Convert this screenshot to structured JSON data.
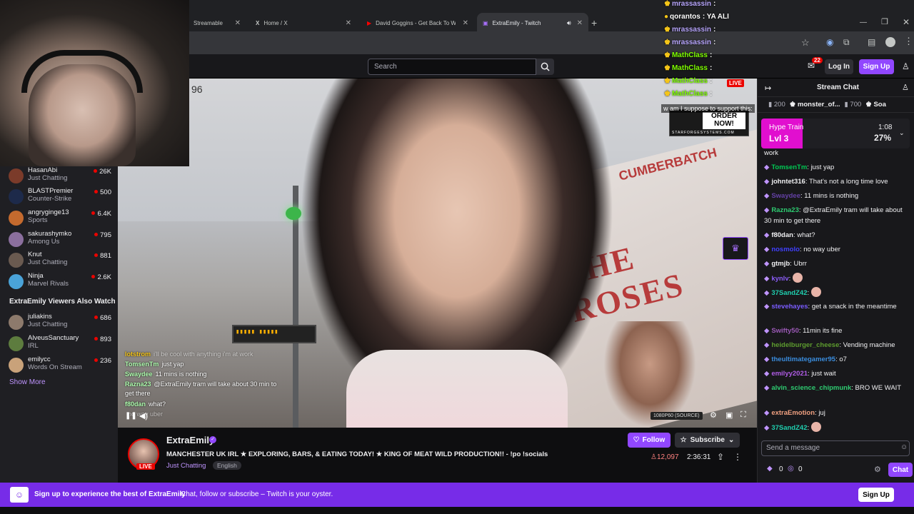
{
  "browser": {
    "tabs": [
      {
        "title": "Streamable"
      },
      {
        "title": "Home / X"
      },
      {
        "title": "David Goggins - Get Back To W"
      },
      {
        "title": "ExtraEmily - Twitch"
      }
    ]
  },
  "topnav": {
    "search_placeholder": "Search",
    "notif_count": "22",
    "login_label": "Log In",
    "signup_label": "Sign Up"
  },
  "overlay_chat": [
    {
      "user": "mrassassin",
      "text": ":"
    },
    {
      "user": "qorantos",
      "text": ": YA ALI"
    },
    {
      "user": "mrassassin",
      "text": ":"
    },
    {
      "user": "mrassassin",
      "text": ":"
    },
    {
      "user": "MathClass",
      "text": ":"
    },
    {
      "user": "MathClass",
      "text": ":"
    },
    {
      "user": "MathClass",
      "text": ":"
    },
    {
      "user": "MathClass",
      "text": ":"
    }
  ],
  "overlay_misc": {
    "live_tag": "LIVE",
    "support_text": "w am I suppose to support this:",
    "order_now": "ORDER NOW!",
    "order_site": "STARFORGESYSTEMS.COM",
    "corner_number": "96"
  },
  "sidebar": {
    "channels": [
      {
        "name": "HasanAbi",
        "category": "Just Chatting",
        "viewers": "26K",
        "color": "#7b3b2a"
      },
      {
        "name": "BLASTPremier",
        "category": "Counter-Strike",
        "viewers": "500",
        "color": "#1d2a4a"
      },
      {
        "name": "angryginge13",
        "category": "Sports",
        "viewers": "6.4K",
        "color": "#c46a2e"
      },
      {
        "name": "sakurashymko",
        "category": "Among Us",
        "viewers": "795",
        "color": "#8b6f9e"
      },
      {
        "name": "Knut",
        "category": "Just Chatting",
        "viewers": "881",
        "color": "#6a5a50"
      },
      {
        "name": "Ninja",
        "category": "Marvel Rivals",
        "viewers": "2.6K",
        "color": "#4aa3d8"
      }
    ],
    "also_watch_title": "ExtraEmily Viewers Also Watch",
    "also_watch": [
      {
        "name": "juliakins",
        "category": "Just Chatting",
        "viewers": "686",
        "color": "#8d7a6c"
      },
      {
        "name": "AlveusSanctuary",
        "category": "IRL",
        "viewers": "893",
        "color": "#5d7c3e"
      },
      {
        "name": "emilycc",
        "category": "Words On Stream",
        "viewers": "236",
        "color": "#c9a27a"
      }
    ],
    "show_more": "Show More"
  },
  "video": {
    "quality": "1080P60 (SOURCE)",
    "sign_text": "THE ROSES",
    "truck_text": "CUMBERBATCH",
    "chat_overlay": [
      {
        "user": "lotstrom",
        "text": "i'll be cool with anything i'm at work"
      },
      {
        "user": "TomsenTm",
        "text": "just yap"
      },
      {
        "user": "Swaydee",
        "text": "11 mins is nothing"
      },
      {
        "user": "Razna23",
        "text": "@ExtraEmily tram will take about 30 min to get there"
      },
      {
        "user": "f80dan",
        "text": "what?"
      },
      {
        "user": "",
        "text": "no way uber"
      }
    ]
  },
  "stream": {
    "channel": "ExtraEmily",
    "title": "MANCHESTER UK IRL ★ EXPLORING, BARS, & EATING TODAY! ★ KING OF MEAT WILD PRODUCTION!! - !po !socials",
    "category": "Just Chatting",
    "tag": "English",
    "live_badge": "LIVE",
    "follow_label": "Follow",
    "subscribe_label": "Subscribe",
    "viewers": "12,097",
    "uptime": "2:36:31"
  },
  "chat": {
    "header": "Stream Chat",
    "gift_leaders": [
      {
        "name": "",
        "amount": "200"
      },
      {
        "name": "monster_of...",
        "amount": "700"
      },
      {
        "name": "Soa",
        "amount": ""
      }
    ],
    "hype_train": {
      "title": "Hype Train",
      "level": "Lvl 3",
      "timer": "1:08",
      "percent": "27%",
      "progress": 0.27
    },
    "messages": [
      {
        "user": "",
        "color": "#efeff1",
        "text": "work"
      },
      {
        "user": "TomsenTm",
        "color": "#00c853",
        "text": "just yap"
      },
      {
        "user": "johntet316",
        "color": "#efeff1",
        "text": "That's not a long time love"
      },
      {
        "user": "Swaydee",
        "color": "#6441a5",
        "text": "11 mins is nothing"
      },
      {
        "user": "Razna23",
        "color": "#2ecc71",
        "text": "@ExtraEmily tram will take about 30 min to get there"
      },
      {
        "user": "f80dan",
        "color": "#efeff1",
        "text": "what?"
      },
      {
        "user": "nosmolo",
        "color": "#4040ff",
        "text": "no way uber"
      },
      {
        "user": "gtmjb",
        "color": "#efeff1",
        "text": "Ubrr"
      },
      {
        "user": "kynlv",
        "color": "#8a5cf6",
        "text": ""
      },
      {
        "user": "37SandZ42",
        "color": "#1fd0b0",
        "text": ""
      },
      {
        "user": "stevehayes",
        "color": "#7a5cff",
        "text": "get a snack in the meantime"
      },
      {
        "user": "Swifty50",
        "color": "#9b59b6",
        "text": "11min its fine"
      },
      {
        "user": "heidelburger_cheese",
        "color": "#5d9c2e",
        "text": "Vending machine"
      },
      {
        "user": "theultimategamer95",
        "color": "#3a8dde",
        "text": "o7"
      },
      {
        "user": "emilyy2021",
        "color": "#b05ce6",
        "text": "just wait"
      },
      {
        "user": "alvin_science_chipmunk",
        "color": "#2ecc71",
        "text": "BRO WE WAIT"
      },
      {
        "user": "extraEmotion",
        "color": "#f0a080",
        "text": "juj"
      },
      {
        "user": "37SandZ42",
        "color": "#1fd0b0",
        "text": ""
      }
    ],
    "input_placeholder": "Send a message",
    "points_a": "0",
    "points_b": "0",
    "chat_button": "Chat"
  },
  "banner": {
    "headline": "Sign up to experience the best of ExtraEmily",
    "sub": "Chat, follow or subscribe – Twitch is your oyster.",
    "signup_label": "Sign Up"
  }
}
